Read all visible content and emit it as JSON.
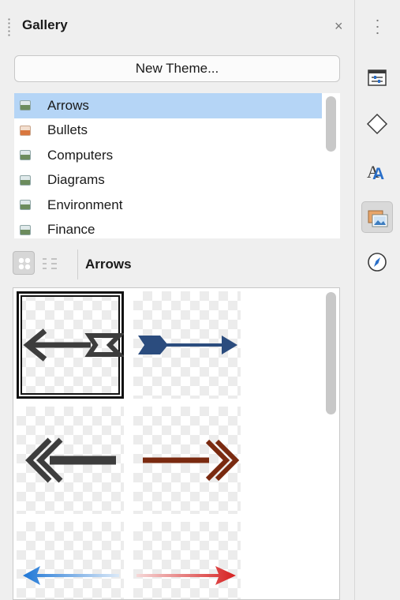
{
  "panel": {
    "title": "Gallery",
    "close_glyph": "×",
    "new_theme_label": "New Theme...",
    "current_theme": "Arrows"
  },
  "themes": [
    {
      "label": "Arrows",
      "selected": true,
      "icon": "image-icon"
    },
    {
      "label": "Bullets",
      "selected": false,
      "icon": "image-icon"
    },
    {
      "label": "Computers",
      "selected": false,
      "icon": "image-icon"
    },
    {
      "label": "Diagrams",
      "selected": false,
      "icon": "image-icon"
    },
    {
      "label": "Environment",
      "selected": false,
      "icon": "image-icon"
    },
    {
      "label": "Finance",
      "selected": false,
      "icon": "image-icon"
    }
  ],
  "view_modes": [
    "icon-view",
    "detailed-view"
  ],
  "gallery_items": [
    {
      "name": "arrow-left-dark-fletched",
      "color": "#3d3d3d",
      "selected": true
    },
    {
      "name": "arrow-right-blue",
      "color": "#2b4c7e",
      "selected": false
    },
    {
      "name": "arrow-left-double-chevron",
      "color": "#3d3d3d",
      "selected": false
    },
    {
      "name": "arrow-right-double-chevron",
      "color": "#7a2a10",
      "selected": false
    },
    {
      "name": "arrow-left-blue-gradient",
      "color": "#1f77d6",
      "selected": false
    },
    {
      "name": "arrow-right-red-gradient",
      "color": "#d62020",
      "selected": false
    }
  ],
  "sidebar_tabs": [
    {
      "name": "properties-tab",
      "icon": "properties-icon",
      "active": false
    },
    {
      "name": "shapes-tab",
      "icon": "shapes-icon",
      "active": false
    },
    {
      "name": "styles-tab",
      "icon": "styles-icon",
      "active": false
    },
    {
      "name": "gallery-tab",
      "icon": "gallery-icon",
      "active": true
    },
    {
      "name": "navigator-tab",
      "icon": "navigator-icon",
      "active": false
    }
  ],
  "colors": {
    "selection": "#b5d5f6",
    "accent_blue": "#2a6fc9"
  }
}
